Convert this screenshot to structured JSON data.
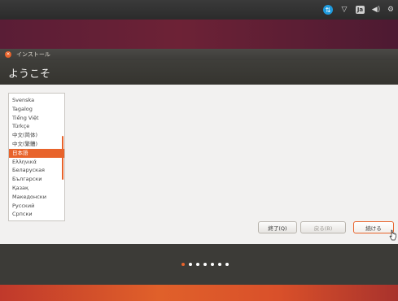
{
  "panel": {
    "icons": [
      "network-icon",
      "wifi-icon",
      "keyboard-icon",
      "volume-icon",
      "settings-icon"
    ],
    "keyboard_label": "Ja"
  },
  "window": {
    "title": "インストール",
    "page_title": "ようこそ",
    "accent_color": "#e8632b"
  },
  "language_list": {
    "items": [
      "Svenska",
      "Tagalog",
      "Tiếng Việt",
      "Türkçe",
      "中文(简体)",
      "中文(繁體)",
      "日本語",
      "Ελληνικά",
      "Беларуская",
      "Български",
      "Қазақ",
      "Македонски",
      "Русский",
      "Српски"
    ],
    "selected": "日本語"
  },
  "buttons": {
    "quit": "終了(Q)",
    "back": "戻る(B)",
    "continue": "続ける"
  },
  "progress": {
    "total_steps": 7,
    "current_step": 1
  }
}
